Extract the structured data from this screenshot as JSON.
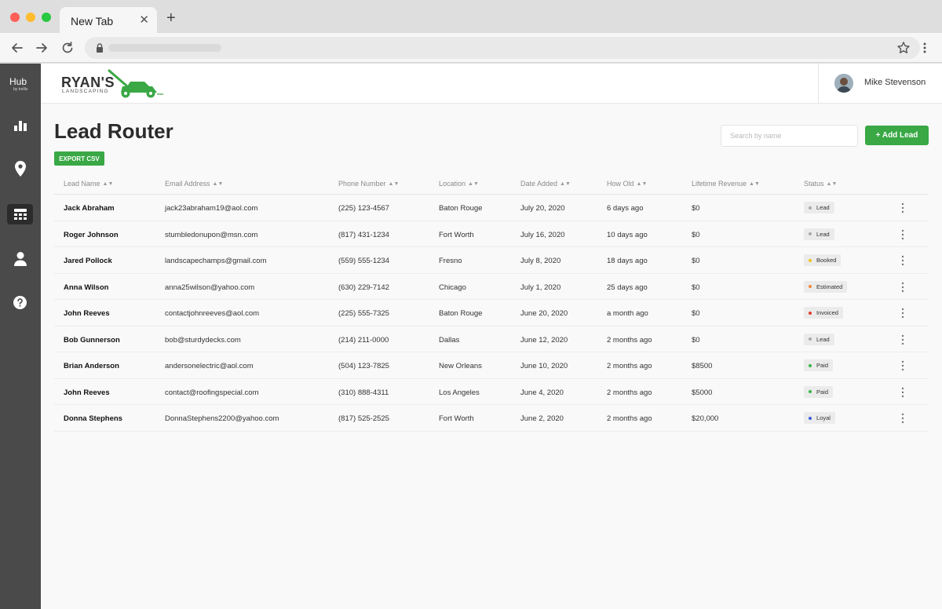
{
  "browser": {
    "tab_title": "New Tab",
    "tab_close": "✕",
    "new_tab": "+"
  },
  "rail": {
    "logo": "Hub",
    "logo_sub": "by trellis",
    "items": [
      {
        "icon": "bar-chart-icon",
        "active": false
      },
      {
        "icon": "map-pin-icon",
        "active": false
      },
      {
        "icon": "table-icon",
        "active": true
      },
      {
        "icon": "user-icon",
        "active": false
      },
      {
        "icon": "help-icon",
        "active": false
      }
    ]
  },
  "header": {
    "brand": "RYAN'S",
    "brand_sub": "LANDSCAPING",
    "user_name": "Mike Stevenson"
  },
  "page": {
    "title": "Lead Router",
    "export_label": "EXPORT CSV",
    "search_placeholder": "Search by name",
    "add_label": "+ Add Lead"
  },
  "table": {
    "columns": [
      "Lead Name",
      "Email Address",
      "Phone Number",
      "Location",
      "Date Added",
      "How Old",
      "Lifetime Revenue",
      "Status"
    ],
    "rows": [
      {
        "name": "Jack Abraham",
        "email": "jack23abraham19@aol.com",
        "phone": "(225) 123-4567",
        "location": "Baton Rouge",
        "date": "July 20, 2020",
        "age": "6 days ago",
        "revenue": "$0",
        "status": "Lead"
      },
      {
        "name": "Roger Johnson",
        "email": "stumbledonupon@msn.com",
        "phone": "(817) 431-1234",
        "location": "Fort Worth",
        "date": "July 16, 2020",
        "age": "10 days ago",
        "revenue": "$0",
        "status": "Lead"
      },
      {
        "name": "Jared Pollock",
        "email": "landscapechamps@gmail.com",
        "phone": "(559) 555-1234",
        "location": "Fresno",
        "date": "July 8, 2020",
        "age": "18 days ago",
        "revenue": "$0",
        "status": "Booked"
      },
      {
        "name": "Anna Wilson",
        "email": "anna25wilson@yahoo.com",
        "phone": "(630) 229-7142",
        "location": "Chicago",
        "date": "July 1, 2020",
        "age": "25 days ago",
        "revenue": "$0",
        "status": "Estimated"
      },
      {
        "name": "John Reeves",
        "email": "contactjohnreeves@aol.com",
        "phone": "(225) 555-7325",
        "location": "Baton Rouge",
        "date": "June 20, 2020",
        "age": "a month ago",
        "revenue": "$0",
        "status": "Invoiced"
      },
      {
        "name": "Bob Gunnerson",
        "email": "bob@sturdydecks.com",
        "phone": "(214) 211-0000",
        "location": "Dallas",
        "date": "June 12, 2020",
        "age": "2 months ago",
        "revenue": "$0",
        "status": "Lead"
      },
      {
        "name": "Brian Anderson",
        "email": "andersonelectric@aol.com",
        "phone": "(504) 123-7825",
        "location": "New Orleans",
        "date": "June 10, 2020",
        "age": "2 months ago",
        "revenue": "$8500",
        "status": "Paid"
      },
      {
        "name": "John Reeves",
        "email": "contact@roofingspecial.com",
        "phone": "(310) 888-4311",
        "location": "Los Angeles",
        "date": "June 4, 2020",
        "age": "2 months ago",
        "revenue": "$5000",
        "status": "Paid"
      },
      {
        "name": "Donna Stephens",
        "email": "DonnaStephens2200@yahoo.com",
        "phone": "(817) 525-2525",
        "location": "Fort Worth",
        "date": "June 2, 2020",
        "age": "2 months ago",
        "revenue": "$20,000",
        "status": "Loyal"
      }
    ]
  },
  "status_colors": {
    "Lead": "#a8a8a8",
    "Booked": "#f2c21b",
    "Estimated": "#f08a3c",
    "Invoiced": "#e23b2e",
    "Paid": "#3bb54a",
    "Loyal": "#3f5bd8"
  },
  "colors": {
    "accent": "#39a845",
    "rail": "#4a4a4a"
  }
}
